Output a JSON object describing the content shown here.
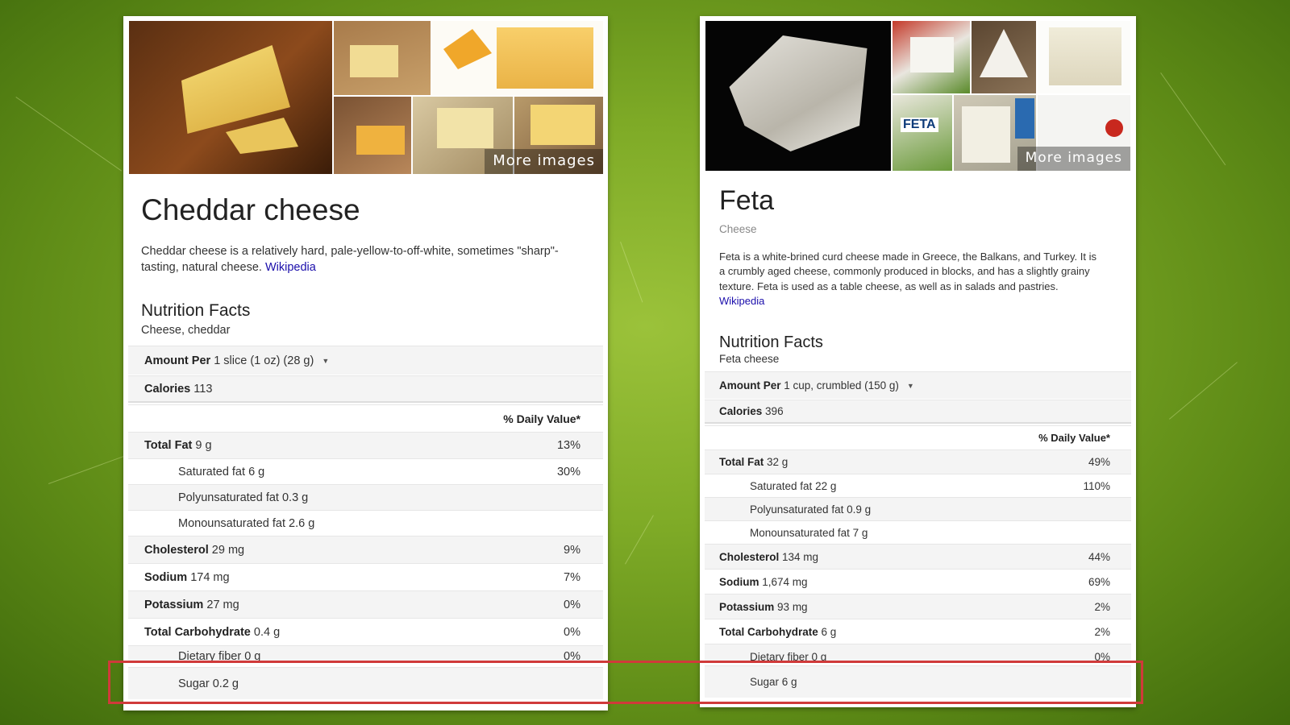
{
  "left_card": {
    "more_images": "More images",
    "title": "Cheddar cheese",
    "description": "Cheddar cheese is a relatively hard, pale-yellow-to-off-white, sometimes \"sharp\"-tasting, natural cheese.",
    "wiki_link": "Wikipedia",
    "nutrition_title": "Nutrition Facts",
    "nutrition_subtitle": "Cheese, cheddar",
    "amount_label": "Amount Per",
    "amount_value": "1 slice (1 oz) (28 g)",
    "calories_label": "Calories",
    "calories_value": "113",
    "daily_value_header": "% Daily Value*",
    "rows": [
      {
        "label": "Total Fat",
        "amount": "9 g",
        "dv": "13%"
      },
      {
        "label": "Saturated fat",
        "amount": "6 g",
        "dv": "30%"
      },
      {
        "label": "Polyunsaturated fat",
        "amount": "0.3 g",
        "dv": ""
      },
      {
        "label": "Monounsaturated fat",
        "amount": "2.6 g",
        "dv": ""
      },
      {
        "label": "Cholesterol",
        "amount": "29 mg",
        "dv": "9%"
      },
      {
        "label": "Sodium",
        "amount": "174 mg",
        "dv": "7%"
      },
      {
        "label": "Potassium",
        "amount": "27 mg",
        "dv": "0%"
      },
      {
        "label": "Total Carbohydrate",
        "amount": "0.4 g",
        "dv": "0%"
      },
      {
        "label": "Dietary fiber",
        "amount": "0 g",
        "dv": "0%"
      },
      {
        "label": "Sugar",
        "amount": "0.2 g",
        "dv": ""
      }
    ]
  },
  "right_card": {
    "more_images": "More images",
    "feta_package_text": "FETA",
    "title": "Feta",
    "subtitle": "Cheese",
    "description": "Feta is a white-brined curd cheese made in Greece, the Balkans, and Turkey. It is a crumbly aged cheese, commonly produced in blocks, and has a slightly grainy texture. Feta is used as a table cheese, as well as in salads and pastries.",
    "wiki_link": "Wikipedia",
    "nutrition_title": "Nutrition Facts",
    "nutrition_subtitle": "Feta cheese",
    "amount_label": "Amount Per",
    "amount_value": "1 cup, crumbled (150 g)",
    "calories_label": "Calories",
    "calories_value": "396",
    "daily_value_header": "% Daily Value*",
    "rows": [
      {
        "label": "Total Fat",
        "amount": "32 g",
        "dv": "49%"
      },
      {
        "label": "Saturated fat",
        "amount": "22 g",
        "dv": "110%"
      },
      {
        "label": "Polyunsaturated fat",
        "amount": "0.9 g",
        "dv": ""
      },
      {
        "label": "Monounsaturated fat",
        "amount": "7 g",
        "dv": ""
      },
      {
        "label": "Cholesterol",
        "amount": "134 mg",
        "dv": "44%"
      },
      {
        "label": "Sodium",
        "amount": "1,674 mg",
        "dv": "69%"
      },
      {
        "label": "Potassium",
        "amount": "93 mg",
        "dv": "2%"
      },
      {
        "label": "Total Carbohydrate",
        "amount": "6 g",
        "dv": "2%"
      },
      {
        "label": "Dietary fiber",
        "amount": "0 g",
        "dv": "0%"
      },
      {
        "label": "Sugar",
        "amount": "6 g",
        "dv": ""
      }
    ]
  },
  "colors": {
    "background": "#7fab27",
    "link": "#1a0dab",
    "highlight": "#d03a3a"
  }
}
